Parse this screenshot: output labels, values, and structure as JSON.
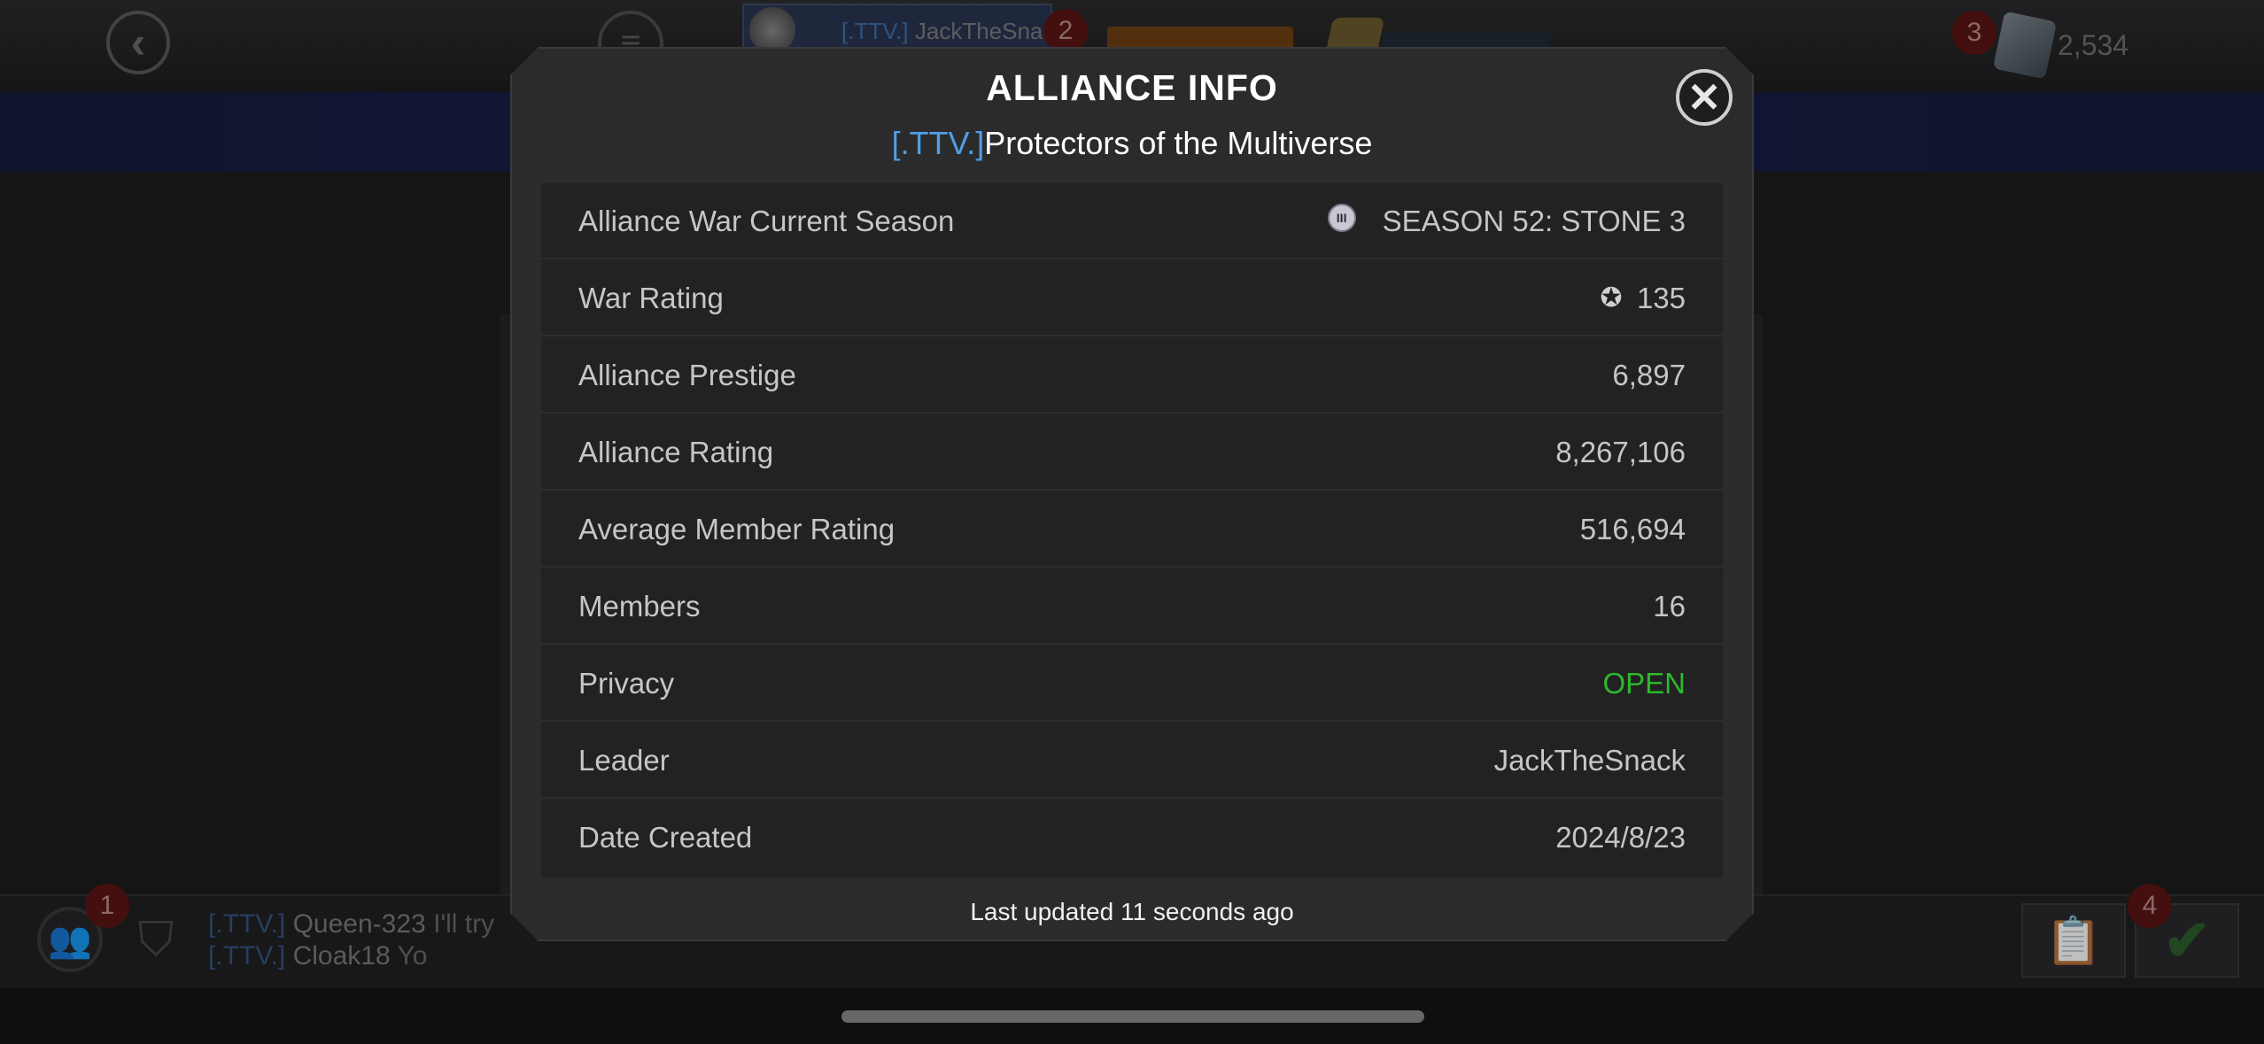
{
  "header": {
    "player_tag": "[.TTV.]",
    "player_name": "JackTheSnac",
    "notification_count_2": "2",
    "notification_count_3": "3",
    "card_count": "2,534"
  },
  "chat": {
    "badge_count": "1",
    "messages": [
      {
        "tag": "[.TTV.]",
        "name": "Queen-323",
        "text": "I'll try"
      },
      {
        "tag": "[.TTV.]",
        "name": "Cloak18",
        "text": "Yo"
      }
    ],
    "quest_badge_count": "4"
  },
  "modal": {
    "title": "ALLIANCE INFO",
    "alliance_tag": "[.TTV.]",
    "alliance_name": "Protectors of the Multiverse",
    "rows": [
      {
        "label": "Alliance War Current Season",
        "value": "SEASON 52: STONE 3",
        "icon": "season-tier-icon"
      },
      {
        "label": "War Rating",
        "value": "135",
        "icon": "war-rating-shield-icon"
      },
      {
        "label": "Alliance Prestige",
        "value": "6,897"
      },
      {
        "label": "Alliance Rating",
        "value": "8,267,106"
      },
      {
        "label": "Average Member Rating",
        "value": "516,694"
      },
      {
        "label": "Members",
        "value": "16"
      },
      {
        "label": "Privacy",
        "value": "OPEN"
      },
      {
        "label": "Leader",
        "value": "JackTheSnack"
      },
      {
        "label": "Date Created",
        "value": "2024/8/23"
      }
    ],
    "footer": "Last updated 11 seconds ago"
  },
  "colors": {
    "tag_blue": "#4f9ee6",
    "open_green": "#2db82d",
    "modal_bg": "#2b2b2c",
    "table_bg": "#222223"
  }
}
